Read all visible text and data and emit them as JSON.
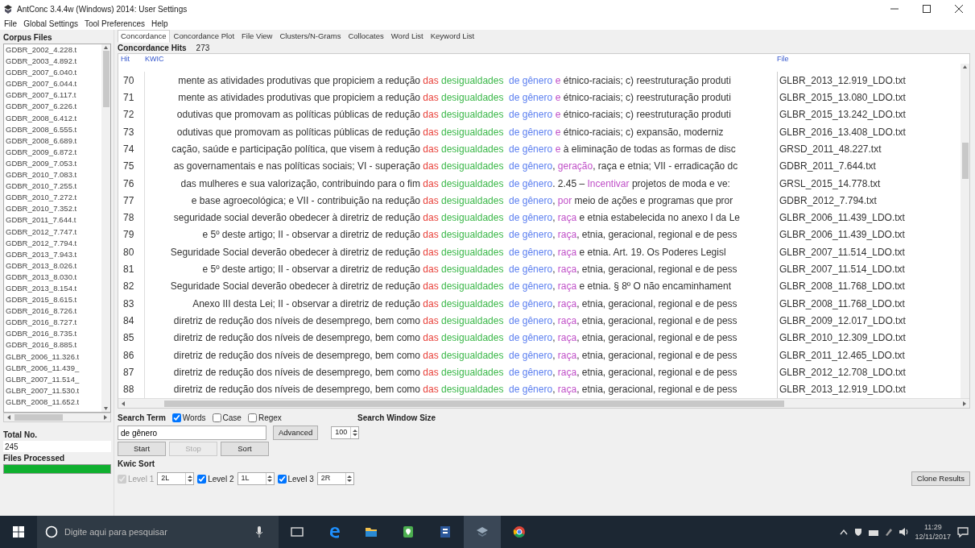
{
  "window": {
    "title": "AntConc 3.4.4w (Windows) 2014: User Settings"
  },
  "menu": [
    "File",
    "Global Settings",
    "Tool Preferences",
    "Help"
  ],
  "corpus_files": {
    "title": "Corpus Files",
    "items": [
      "GDBR_2002_4.228.t",
      "GDBR_2003_4.892.t",
      "GDBR_2007_6.040.t",
      "GDBR_2007_6.044.t",
      "GDBR_2007_6.117.t",
      "GDBR_2007_6.226.t",
      "GDBR_2008_6.412.t",
      "GDBR_2008_6.555.t",
      "GDBR_2008_6.689.t",
      "GDBR_2009_6.872.t",
      "GDBR_2009_7.053.t",
      "GDBR_2010_7.083.t",
      "GDBR_2010_7.255.t",
      "GDBR_2010_7.272.t",
      "GDBR_2010_7.352.t",
      "GDBR_2011_7.644.t",
      "GDBR_2012_7.747.t",
      "GDBR_2012_7.794.t",
      "GDBR_2013_7.943.t",
      "GDBR_2013_8.026.t",
      "GDBR_2013_8.030.t",
      "GDBR_2013_8.154.t",
      "GDBR_2015_8.615.t",
      "GDBR_2016_8.726.t",
      "GDBR_2016_8.727.t",
      "GDBR_2016_8.735.t",
      "GDBR_2016_8.885.t",
      "GLBR_2006_11.326.t",
      "GLBR_2006_11.439_",
      "GLBR_2007_11.514_",
      "GLBR_2007_11.530.t",
      "GLBR_2008_11.652.t"
    ],
    "total_label": "Total No.",
    "total": "245",
    "processed": {
      "label": "Files Processed",
      "level": 1
    }
  },
  "tabs": [
    {
      "label": "Concordance",
      "selected": true
    },
    {
      "label": "Concordance Plot",
      "selected": false
    },
    {
      "label": "File View",
      "selected": false
    },
    {
      "label": "Clusters/N-Grams",
      "selected": false
    },
    {
      "label": "Collocates",
      "selected": false
    },
    {
      "label": "Word List",
      "selected": false
    },
    {
      "label": "Keyword List",
      "selected": false
    }
  ],
  "hits": {
    "label": "Concordance Hits",
    "count": "273"
  },
  "columns": [
    "Hit",
    "KWIC",
    "File"
  ],
  "rows": [
    {
      "hit": "70",
      "left": "mente as atividades produtivas que propiciem a redução",
      "key_1": "das",
      "key_2": "desigualdades",
      "term": "de gênero",
      "right": [
        {
          "kind": "sorted",
          "text": "e"
        },
        {
          "kind": "plain",
          "text": " étnico-raciais; c) reestruturação produti"
        }
      ],
      "file": "GLBR_2013_12.919_LDO.txt"
    },
    {
      "hit": "71",
      "left": "mente as atividades produtivas que propiciem a redução",
      "key_1": "das",
      "key_2": "desigualdades",
      "term": "de gênero",
      "right": [
        {
          "kind": "sorted",
          "text": "e"
        },
        {
          "kind": "plain",
          "text": " étnico-raciais; c) reestruturação produti"
        }
      ],
      "file": "GLBR_2015_13.080_LDO.txt"
    },
    {
      "hit": "72",
      "left": "odutivas que promovam as políticas públicas de redução",
      "key_1": "das",
      "key_2": "desigualdades",
      "term": "de gênero",
      "right": [
        {
          "kind": "sorted",
          "text": "e"
        },
        {
          "kind": "plain",
          "text": " étnico-raciais; c) reestruturação produti"
        }
      ],
      "file": "GLBR_2015_13.242_LDO.txt"
    },
    {
      "hit": "73",
      "left": "odutivas que promovam as políticas públicas de redução",
      "key_1": "das",
      "key_2": "desigualdades",
      "term": "de gênero",
      "right": [
        {
          "kind": "sorted",
          "text": "e"
        },
        {
          "kind": "plain",
          "text": " étnico-raciais; c) expansão, moderniz"
        }
      ],
      "file": "GLBR_2016_13.408_LDO.txt"
    },
    {
      "hit": "74",
      "left": "cação, saúde e participação política, que visem à redução",
      "key_1": "das",
      "key_2": "desigualdades",
      "term": "de gênero",
      "right": [
        {
          "kind": "sorted",
          "text": "e"
        },
        {
          "kind": "plain",
          "text": " à eliminação de todas as formas de disc"
        }
      ],
      "file": "GRSD_2011_48.227.txt"
    },
    {
      "hit": "75",
      "left": "as governamentais e nas políticas sociais; VI - superação",
      "key_1": "das",
      "key_2": "desigualdades",
      "term": "de gênero",
      "right": [
        {
          "kind": "plain",
          "text": ", "
        },
        {
          "kind": "sorted",
          "text": "geração"
        },
        {
          "kind": "plain",
          "text": ", raça e etnia; VII - erradicação dc"
        }
      ],
      "file": "GDBR_2011_7.644.txt"
    },
    {
      "hit": "76",
      "left": "das mulheres e sua valorização, contribuindo para o fim",
      "key_1": "das",
      "key_2": "desigualdades",
      "term": "de gênero",
      "right": [
        {
          "kind": "plain",
          "text": ". 2.45 – "
        },
        {
          "kind": "sorted",
          "text": "Incentivar"
        },
        {
          "kind": "plain",
          "text": " projetos de moda e ve:"
        }
      ],
      "file": "GRSL_2015_14.778.txt"
    },
    {
      "hit": "77",
      "left": "e base agroecológica; e VII - contribuição na redução",
      "key_1": "das",
      "key_2": "desigualdades",
      "term": "de gênero",
      "right": [
        {
          "kind": "plain",
          "text": ", "
        },
        {
          "kind": "sorted",
          "text": "por"
        },
        {
          "kind": "plain",
          "text": " meio de ações e programas que pror"
        }
      ],
      "file": "GDBR_2012_7.794.txt"
    },
    {
      "hit": "78",
      "left": "seguridade social deverão obedecer à diretriz de redução",
      "key_1": "das",
      "key_2": "desigualdades",
      "term": "de gênero",
      "right": [
        {
          "kind": "plain",
          "text": ", "
        },
        {
          "kind": "sorted",
          "text": "raça"
        },
        {
          "kind": "plain",
          "text": " e etnia estabelecida no anexo I da Le"
        }
      ],
      "file": "GLBR_2006_11.439_LDO.txt"
    },
    {
      "hit": "79",
      "left": "e 5º deste artigo; II - observar a diretriz de redução",
      "key_1": "das",
      "key_2": "desigualdades",
      "term": "de gênero",
      "right": [
        {
          "kind": "plain",
          "text": ", "
        },
        {
          "kind": "sorted",
          "text": "raça"
        },
        {
          "kind": "plain",
          "text": ", etnia, geracional, regional e de pess"
        }
      ],
      "file": "GLBR_2006_11.439_LDO.txt"
    },
    {
      "hit": "80",
      "left": "Seguridade Social deverão obedecer à diretriz de redução",
      "key_1": "das",
      "key_2": "desigualdades",
      "term": "de gênero",
      "right": [
        {
          "kind": "plain",
          "text": ", "
        },
        {
          "kind": "sorted",
          "text": "raça"
        },
        {
          "kind": "plain",
          "text": " e etnia. Art. 19. Os Poderes Legisl"
        }
      ],
      "file": "GLBR_2007_11.514_LDO.txt"
    },
    {
      "hit": "81",
      "left": "e 5º deste artigo; II - observar a diretriz de redução",
      "key_1": "das",
      "key_2": "desigualdades",
      "term": "de gênero",
      "right": [
        {
          "kind": "plain",
          "text": ", "
        },
        {
          "kind": "sorted",
          "text": "raça"
        },
        {
          "kind": "plain",
          "text": ", etnia, geracional, regional e de pess"
        }
      ],
      "file": "GLBR_2007_11.514_LDO.txt"
    },
    {
      "hit": "82",
      "left": "Seguridade Social deverão obedecer à diretriz de redução",
      "key_1": "das",
      "key_2": "desigualdades",
      "term": "de gênero",
      "right": [
        {
          "kind": "plain",
          "text": ", "
        },
        {
          "kind": "sorted",
          "text": "raça"
        },
        {
          "kind": "plain",
          "text": " e etnia. § 8º O não encaminhament"
        }
      ],
      "file": "GLBR_2008_11.768_LDO.txt"
    },
    {
      "hit": "83",
      "left": "Anexo III desta Lei; II - observar a diretriz de redução",
      "key_1": "das",
      "key_2": "desigualdades",
      "term": "de gênero",
      "right": [
        {
          "kind": "plain",
          "text": ", "
        },
        {
          "kind": "sorted",
          "text": "raça"
        },
        {
          "kind": "plain",
          "text": ", etnia, geracional, regional e de pess"
        }
      ],
      "file": "GLBR_2008_11.768_LDO.txt"
    },
    {
      "hit": "84",
      "left": "diretriz de redução dos níveis de desemprego, bem como",
      "key_1": "das",
      "key_2": "desigualdades",
      "term": "de gênero",
      "right": [
        {
          "kind": "plain",
          "text": ", "
        },
        {
          "kind": "sorted",
          "text": "raça"
        },
        {
          "kind": "plain",
          "text": ", etnia, geracional, regional e de pess"
        }
      ],
      "file": "GLBR_2009_12.017_LDO.txt"
    },
    {
      "hit": "85",
      "left": "diretriz de redução dos níveis de desemprego, bem como",
      "key_1": "das",
      "key_2": "desigualdades",
      "term": "de gênero",
      "right": [
        {
          "kind": "plain",
          "text": ", "
        },
        {
          "kind": "sorted",
          "text": "raça"
        },
        {
          "kind": "plain",
          "text": ", etnia, geracional, regional e de pess"
        }
      ],
      "file": "GLBR_2010_12.309_LDO.txt"
    },
    {
      "hit": "86",
      "left": "diretriz de redução dos níveis de desemprego, bem como",
      "key_1": "das",
      "key_2": "desigualdades",
      "term": "de gênero",
      "right": [
        {
          "kind": "plain",
          "text": ", "
        },
        {
          "kind": "sorted",
          "text": "raça"
        },
        {
          "kind": "plain",
          "text": ", etnia, geracional, regional e de pess"
        }
      ],
      "file": "GLBR_2011_12.465_LDO.txt"
    },
    {
      "hit": "87",
      "left": "diretriz de redução dos níveis de desemprego, bem como",
      "key_1": "das",
      "key_2": "desigualdades",
      "term": "de gênero",
      "right": [
        {
          "kind": "plain",
          "text": ", "
        },
        {
          "kind": "sorted",
          "text": "raça"
        },
        {
          "kind": "plain",
          "text": ", etnia, geracional, regional e de pess"
        }
      ],
      "file": "GLBR_2012_12.708_LDO.txt"
    },
    {
      "hit": "88",
      "left": "diretriz de redução dos níveis de desemprego, bem como",
      "key_1": "das",
      "key_2": "desigualdades",
      "term": "de gênero",
      "right": [
        {
          "kind": "plain",
          "text": ", "
        },
        {
          "kind": "sorted",
          "text": "raça"
        },
        {
          "kind": "plain",
          "text": ", etnia, geracional, regional e de pess"
        }
      ],
      "file": "GLBR_2013_12.919_LDO.txt"
    }
  ],
  "search": {
    "label": "Search Term",
    "options": [
      {
        "label": "Words",
        "checked": true
      },
      {
        "label": "Case",
        "checked": false
      },
      {
        "label": "Regex",
        "checked": false
      }
    ],
    "value": "de gênero",
    "advanced": "Advanced",
    "window_label": "Search Window Size",
    "window_size": "100"
  },
  "buttons": [
    {
      "label": "Start",
      "disabled": false
    },
    {
      "label": "Stop",
      "disabled": true
    },
    {
      "label": "Sort",
      "disabled": false
    }
  ],
  "kwic_sort": {
    "label": "Kwic Sort",
    "levels": [
      {
        "label": "Level 1",
        "checked": true,
        "disabled": true,
        "value": "2L"
      },
      {
        "label": "Level 2",
        "checked": true,
        "disabled": false,
        "value": "1L"
      },
      {
        "label": "Level 3",
        "checked": true,
        "disabled": false,
        "value": "2R"
      }
    ]
  },
  "clone": "Clone Results",
  "taskbar": {
    "search_placeholder": "Digite aqui para pesquisar",
    "time": "11:29",
    "date": "12/11/2017"
  }
}
